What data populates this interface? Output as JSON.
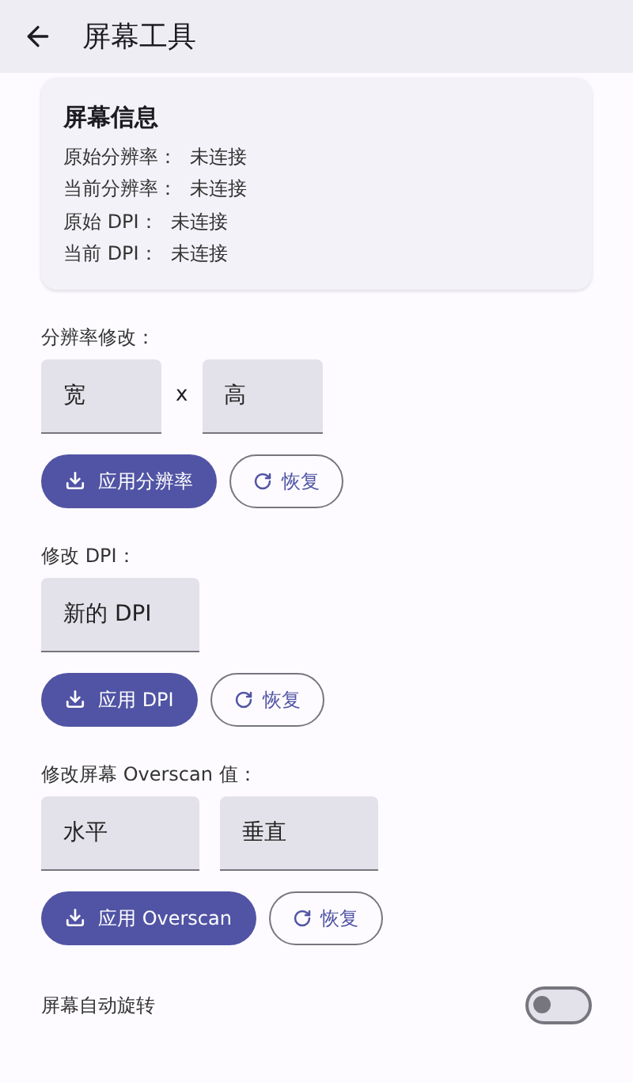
{
  "app_bar": {
    "title": "屏幕工具"
  },
  "info_card": {
    "title": "屏幕信息",
    "rows": [
      {
        "label": "原始分辨率：",
        "value": "未连接"
      },
      {
        "label": "当前分辨率：",
        "value": "未连接"
      },
      {
        "label": "原始 DPI：",
        "value": "未连接"
      },
      {
        "label": "当前 DPI：",
        "value": "未连接"
      }
    ]
  },
  "sections": [
    {
      "label": "分辨率修改：",
      "fields": [
        {
          "placeholder": "宽"
        },
        {
          "placeholder": "高"
        }
      ],
      "separator": "x",
      "apply_button": "应用分辨率",
      "reset_button": "恢复"
    },
    {
      "label": "修改 DPI：",
      "fields": [
        {
          "placeholder": "新的 DPI"
        }
      ],
      "apply_button": "应用 DPI",
      "reset_button": "恢复"
    },
    {
      "label": "修改屏幕 Overscan 值：",
      "fields": [
        {
          "placeholder": "水平"
        },
        {
          "placeholder": "垂直"
        }
      ],
      "apply_button": "应用 Overscan",
      "reset_button": "恢复"
    }
  ],
  "toggle": {
    "label": "屏幕自动旋转",
    "on": false
  }
}
